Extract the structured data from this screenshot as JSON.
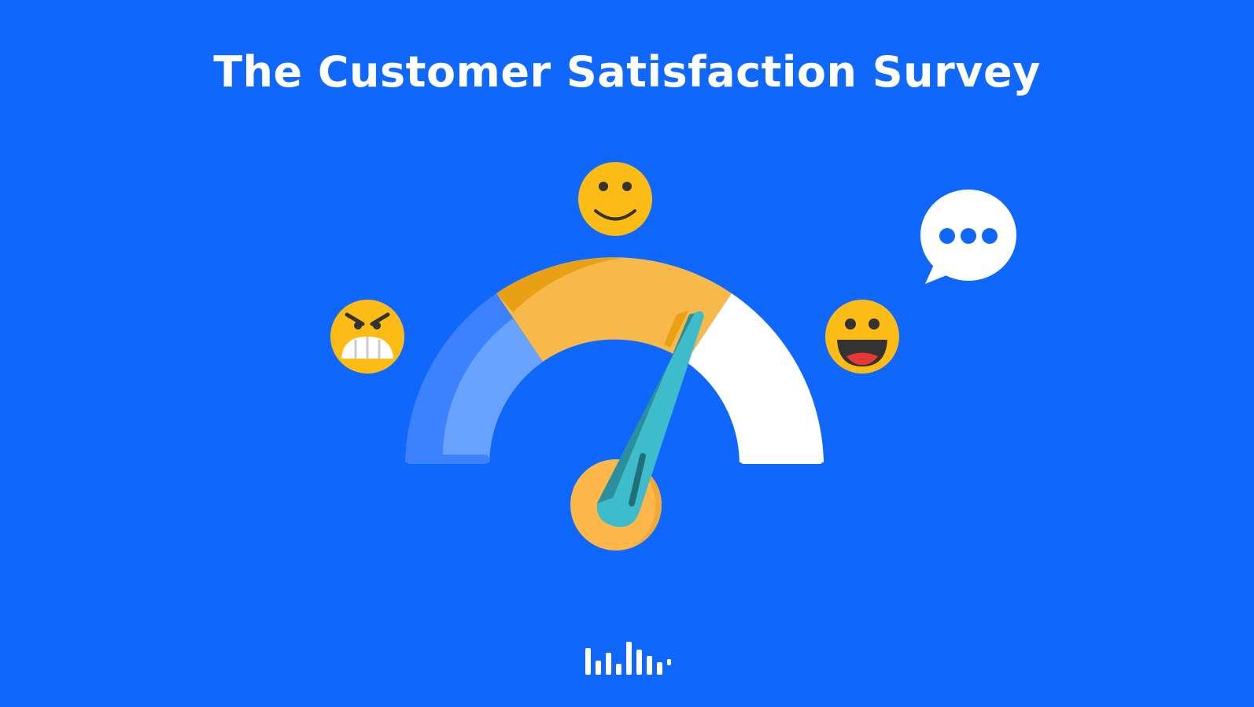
{
  "title": "The Customer Satisfaction Survey",
  "gauge": {
    "segments": [
      "dissatisfied",
      "neutral",
      "satisfied"
    ],
    "needle_level": 0.62
  },
  "colors": {
    "background": "#1067FB",
    "gauge_left": "#3C82FF",
    "gauge_left_inner": "#5E9BFF",
    "gauge_mid": "#F9B94A",
    "gauge_mid_dark": "#EAA015",
    "gauge_right": "#FFFFFF",
    "needle": "#3EBCCB",
    "needle_dark": "#2B8F9C",
    "hub": "#FDB849",
    "emoji": "#FDBB16"
  },
  "icons": [
    "angry-face-icon",
    "smile-face-icon",
    "laughing-face-icon",
    "chat-bubble-icon",
    "brand-logo-icon"
  ]
}
